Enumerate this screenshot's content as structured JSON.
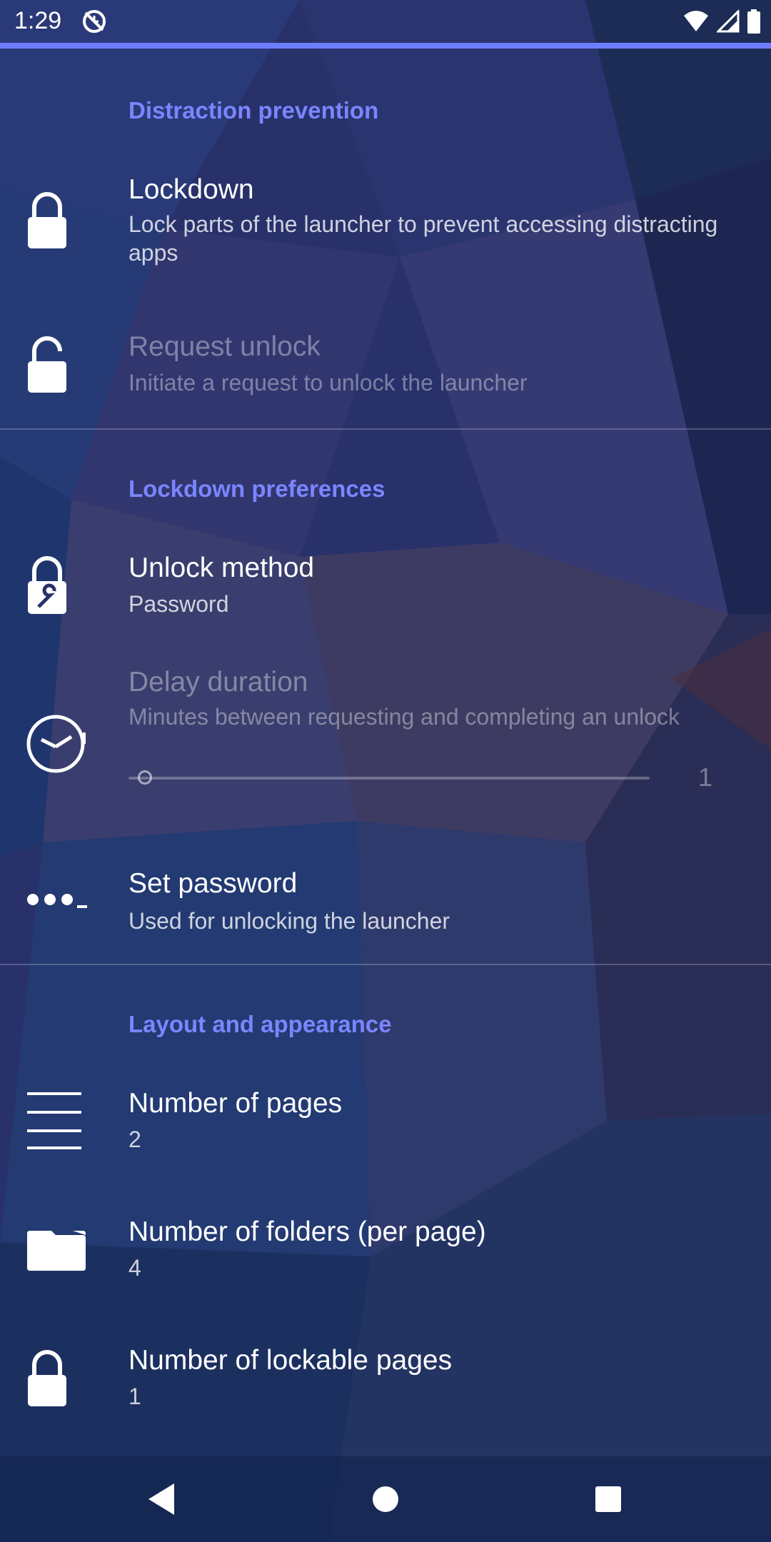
{
  "colors": {
    "accent": "#6d7dff",
    "section_header": "#7b85ff",
    "background": "#26305e"
  },
  "status_bar": {
    "time": "1:29",
    "icons": [
      "sync-disabled-icon",
      "wifi-icon",
      "signal-icon",
      "battery-icon"
    ]
  },
  "sections": [
    {
      "header": "Distraction prevention",
      "items": [
        {
          "title": "Lockdown",
          "summary": "Lock parts of the launcher to prevent accessing distracting apps",
          "icon": "lock-icon",
          "enabled": true
        },
        {
          "title": "Request unlock",
          "summary": "Initiate a request to unlock the launcher",
          "icon": "lock-open-icon",
          "enabled": false
        }
      ]
    },
    {
      "header": "Lockdown preferences",
      "items": [
        {
          "title": "Unlock method",
          "summary": "Password",
          "icon": "lock-wrench-icon",
          "enabled": true
        },
        {
          "title": "Delay duration",
          "summary": "Minutes between requesting and completing an unlock",
          "icon": "timer-icon",
          "enabled": false,
          "slider_value": "1"
        },
        {
          "title": "Set password",
          "summary": "Used for unlocking the launcher",
          "icon": "password-icon",
          "enabled": true
        }
      ]
    },
    {
      "header": "Layout and appearance",
      "items": [
        {
          "title": "Number of pages",
          "summary": "2",
          "icon": "menu-lines-icon",
          "enabled": true
        },
        {
          "title": "Number of folders (per page)",
          "summary": "4",
          "icon": "folder-icon",
          "enabled": true
        },
        {
          "title": "Number of lockable pages",
          "summary": "1",
          "icon": "lock-icon",
          "enabled": true
        }
      ]
    }
  ],
  "nav_bar": {
    "buttons": [
      "back-icon",
      "home-icon",
      "recents-icon"
    ]
  }
}
